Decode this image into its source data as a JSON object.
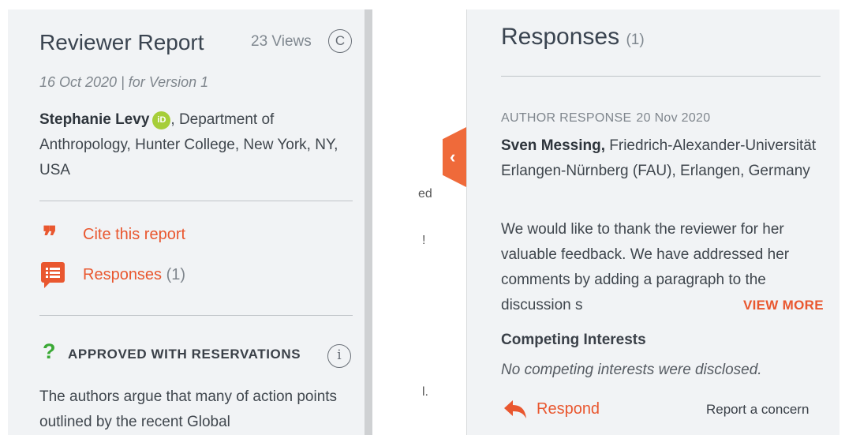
{
  "reviewer_report": {
    "title": "Reviewer Report",
    "views": "23 Views",
    "license_icon": "creative-commons-icon",
    "license_glyph": "C",
    "date_version": "16 Oct 2020 | for Version 1",
    "author_name": "Stephanie Levy",
    "orcid_glyph": "iD",
    "affiliation": ", Department of Anthropology, Hunter College, New York, NY, USA",
    "cite_label": "Cite this report",
    "responses_label": "Responses",
    "responses_count": "(1)",
    "status_glyph": "?",
    "status": "APPROVED WITH RESERVATIONS",
    "info_glyph": "i",
    "body_text": "The authors argue that many of action points outlined by the recent Global"
  },
  "background_fragments": [
    "ed",
    "!",
    "l."
  ],
  "toggle": {
    "glyph": "‹",
    "icon": "chevron-left-icon"
  },
  "responses_panel": {
    "title": "Responses",
    "count": "(1)",
    "response_type": "AUTHOR RESPONSE",
    "response_date": "20 Nov 2020",
    "author_name": "Sven Messing,",
    "affiliation": " Friedrich-Alexander-Universität Erlangen-Nürnberg (FAU), Erlangen, Germany",
    "body_text": "We would like to thank the reviewer for her valuable feedback. We have addressed her comments by adding a paragraph to the discussion s",
    "view_more_label": "VIEW MORE",
    "competing_title": "Competing Interests",
    "competing_text": "No competing interests were disclosed.",
    "respond_label": "Respond",
    "report_label": "Report a concern"
  },
  "colors": {
    "accent": "#e9572f",
    "panel_bg": "#f1f3f5",
    "approved_green": "#3aa935",
    "orcid_green": "#a6ce39"
  }
}
